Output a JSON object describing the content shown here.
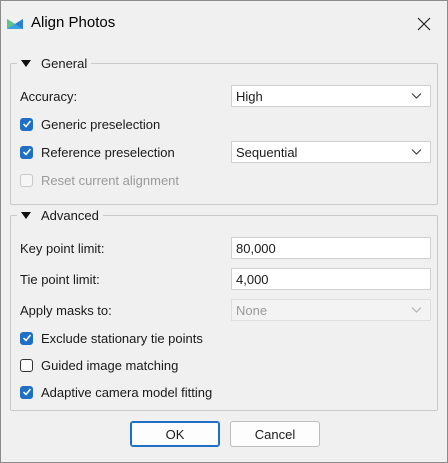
{
  "window": {
    "title": "Align Photos",
    "icon": "align-photos-app-icon",
    "close_icon": "close-icon"
  },
  "general": {
    "title": "General",
    "accuracy_label": "Accuracy:",
    "accuracy_value": "High",
    "generic_preselection_label": "Generic preselection",
    "generic_preselection_checked": true,
    "reference_preselection_label": "Reference preselection",
    "reference_preselection_checked": true,
    "reference_mode_value": "Sequential",
    "reset_alignment_label": "Reset current alignment",
    "reset_alignment_checked": false,
    "reset_alignment_enabled": false
  },
  "advanced": {
    "title": "Advanced",
    "key_point_limit_label": "Key point limit:",
    "key_point_limit_value": "80,000",
    "tie_point_limit_label": "Tie point limit:",
    "tie_point_limit_value": "4,000",
    "apply_masks_label": "Apply masks to:",
    "apply_masks_value": "None",
    "apply_masks_enabled": false,
    "exclude_stationary_label": "Exclude stationary tie points",
    "exclude_stationary_checked": true,
    "guided_matching_label": "Guided image matching",
    "guided_matching_checked": false,
    "adaptive_fitting_label": "Adaptive camera model fitting",
    "adaptive_fitting_checked": true
  },
  "buttons": {
    "ok": "OK",
    "cancel": "Cancel"
  },
  "colors": {
    "accent": "#1f6fc5",
    "dialog_bg": "#f0f0f0",
    "disabled_text": "#9a9a9a"
  }
}
